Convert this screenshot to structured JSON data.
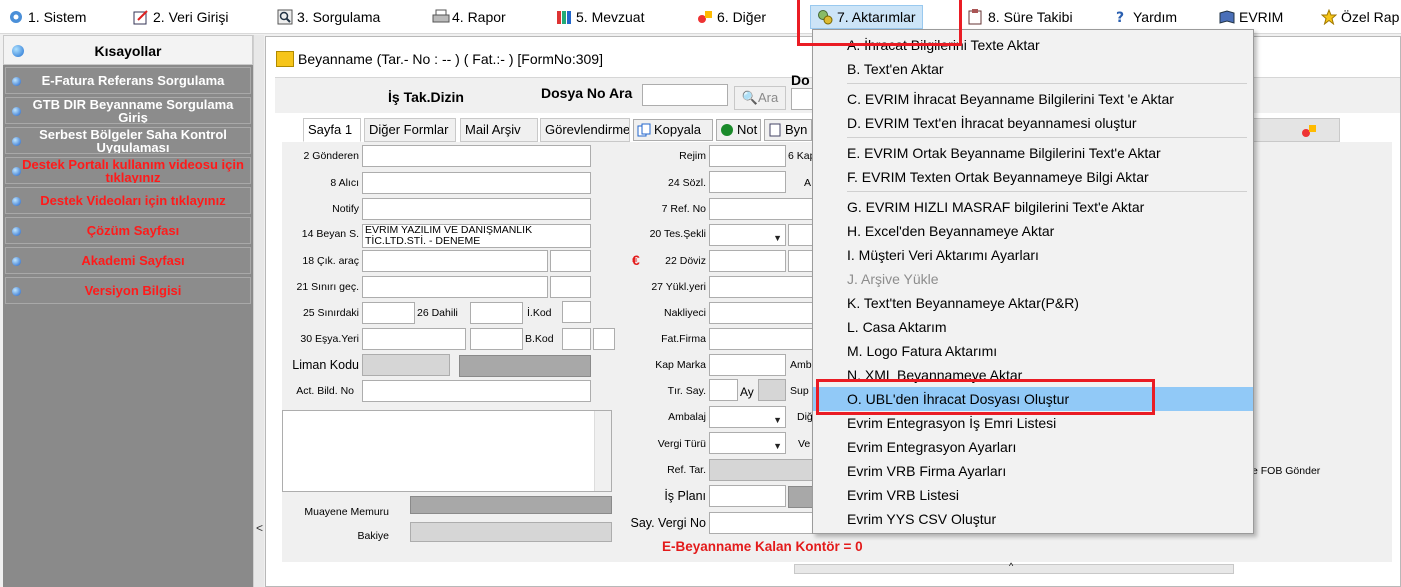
{
  "menubar": {
    "items": [
      {
        "label": "1.  Sistem",
        "icon": "system-icon"
      },
      {
        "label": "2.  Veri Girişi",
        "icon": "data-entry-icon"
      },
      {
        "label": "3.  Sorgulama",
        "icon": "query-icon"
      },
      {
        "label": "4.  Rapor",
        "icon": "printer-icon"
      },
      {
        "label": "5.  Mevzuat",
        "icon": "books-icon"
      },
      {
        "label": "6.  Diğer",
        "icon": "shapes-icon"
      },
      {
        "label": "7.  Aktarımlar",
        "icon": "transfer-icon"
      },
      {
        "label": "8. Süre Takibi",
        "icon": "clipboard-icon"
      },
      {
        "label": "Yardım",
        "icon": "help-icon"
      },
      {
        "label": "EVRIM",
        "icon": "book-icon"
      },
      {
        "label": "Özel Rap",
        "icon": "star-icon"
      }
    ]
  },
  "sidebar": {
    "title": "Kısayollar",
    "items": [
      {
        "label": "E-Fatura Referans Sorgulama",
        "color": "white"
      },
      {
        "label": "GTB DIR Beyanname Sorgulama Giriş",
        "color": "white"
      },
      {
        "label": "Serbest Bölgeler Saha Kontrol Uygulaması",
        "color": "white"
      },
      {
        "label": "Destek Portalı kullanım videosu için tıklayınız",
        "color": "red"
      },
      {
        "label": "Destek Videoları için tıklayınız",
        "color": "red"
      },
      {
        "label": "Çözüm Sayfası",
        "color": "red"
      },
      {
        "label": "Akademi Sayfası",
        "color": "red"
      },
      {
        "label": "Versiyon Bilgisi",
        "color": "red"
      }
    ]
  },
  "window": {
    "title": "Beyanname (Tar.- No :  --  ) ( Fat.:- )   [FormNo:309]",
    "is_tak_dizin": "İş Tak.Dizin",
    "dosya_no_label": "Dosya No Ara",
    "ara_button": "Ara",
    "do_label": "Do"
  },
  "tabs": {
    "items": [
      "Sayfa 1",
      "Diğer Formlar",
      "Mail Arşiv",
      "Görevlendirme"
    ],
    "buttons": [
      "Kopyala",
      "Not",
      "Byn"
    ]
  },
  "form": {
    "labels": {
      "gonderen": "2 Gönderen",
      "alici": "8 Alıcı",
      "notify": "Notify",
      "beyan": "14 Beyan S.",
      "cik_arac": "18 Çık. araç",
      "sinir_gec": "21 Sınırı geç.",
      "sinirdaki": "25 Sınırdaki",
      "dahili": "26 Dahili",
      "ikod": "İ.Kod",
      "esya_yeri": "30 Eşya.Yeri",
      "bkod": "B.Kod",
      "liman_kodu": "Liman Kodu",
      "act_bild_no": "Act. Bild. No",
      "muayene_memuru": "Muayene Memuru",
      "bakiye": "Bakiye",
      "rejim": "Rejim",
      "kap_short": "6 Kap",
      "sozl": "24 Sözl.",
      "a_short": "A",
      "ref_no": "7 Ref. No",
      "tes_sekli": "20 Tes.Şekli",
      "doviz": "22 Döviz",
      "euro": "€",
      "yukl_yeri": "27 Yükl.yeri",
      "nakliyeci": "Nakliyeci",
      "fat_firma": "Fat.Firma",
      "kap_marka": "Kap Marka",
      "amb_short": "Amb",
      "tir_say": "Tır. Say.",
      "ay": "Ay",
      "sup_short": "Sup",
      "ambalaj": "Ambalaj",
      "di_short": "Diğ",
      "vergi_turu": "Vergi Türü",
      "ve_short": "Ve",
      "ref_tar": "Ref. Tar.",
      "is_plani": "İş Planı",
      "say_vergi_no": "Say. Vergi No",
      "fob_gonder": "e FOB Gönder"
    },
    "beyan_value": "EVRİM YAZILIM VE DANIŞMANLIK TİC.LTD.STİ. - DENEME",
    "kontor_text": "E-Beyanname Kalan Kontör = 0"
  },
  "dropdown": {
    "items": [
      {
        "label": "A.   İhracat Bilgilerini Texte  Aktar",
        "state": "normal"
      },
      {
        "label": "B.   Text'en Aktar",
        "state": "normal"
      },
      {
        "label": "C.   EVRIM İhracat Beyanname Bilgilerini Text 'e Aktar",
        "state": "normal"
      },
      {
        "label": "D.   EVRIM Text'en İhracat beyannamesi oluştur",
        "state": "normal"
      },
      {
        "label": "E.   EVRIM Ortak Beyanname Bilgilerini Text'e Aktar",
        "state": "normal"
      },
      {
        "label": "F.   EVRIM Texten  Ortak Beyannameye Bilgi Aktar",
        "state": "normal"
      },
      {
        "label": "G.   EVRIM HIZLI MASRAF  bilgilerini Text'e Aktar",
        "state": "normal"
      },
      {
        "label": "H.   Excel'den Beyannameye Aktar",
        "state": "normal"
      },
      {
        "label": "I.  Müşteri Veri Aktarımı Ayarları",
        "state": "normal"
      },
      {
        "label": "J.  Arşive Yükle",
        "state": "disabled"
      },
      {
        "label": "K.  Text'ten Beyannameye Aktar(P&R)",
        "state": "normal"
      },
      {
        "label": "L.  Casa Aktarım",
        "state": "normal"
      },
      {
        "label": "M. Logo Fatura Aktarımı",
        "state": "normal"
      },
      {
        "label": "N. XML Beyannameye Aktar",
        "state": "normal"
      },
      {
        "label": "O. UBL'den İhracat Dosyası Oluştur",
        "state": "highlighted"
      },
      {
        "label": "Evrim Entegrasyon İş Emri Listesi",
        "state": "normal"
      },
      {
        "label": "Evrim Entegrasyon Ayarları",
        "state": "normal"
      },
      {
        "label": "Evrim VRB Firma Ayarları",
        "state": "normal"
      },
      {
        "label": "Evrim VRB Listesi",
        "state": "normal"
      },
      {
        "label": "Evrim YYS CSV Oluştur",
        "state": "normal"
      }
    ]
  },
  "colors": {
    "highlight_box": "#ea1c24",
    "menu_hover": "#91c9f7",
    "sidebar_bg": "#8a8a8a",
    "red_text": "#ff1a1a"
  }
}
